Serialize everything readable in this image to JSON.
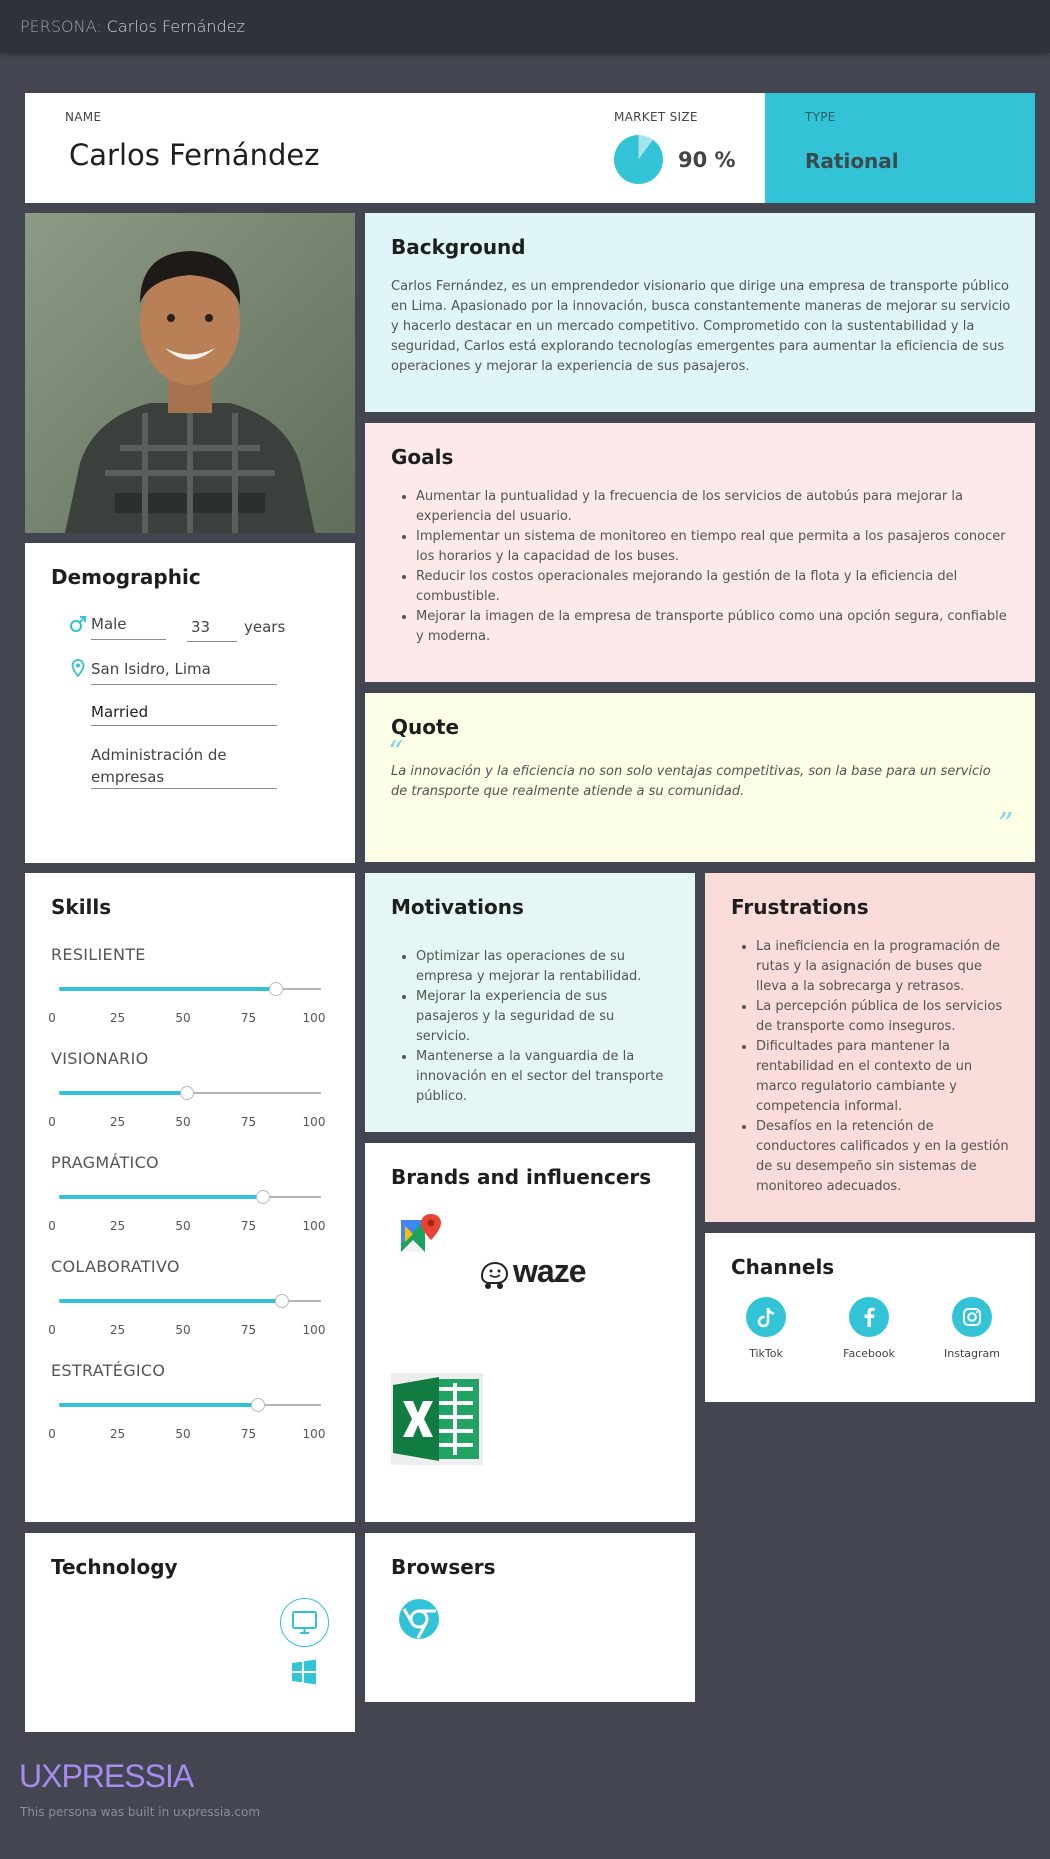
{
  "topbar": {
    "prefix": "PERSONA:",
    "name": "Carlos Fernández"
  },
  "header": {
    "name_label": "NAME",
    "name": "Carlos Fernández",
    "market_label": "MARKET SIZE",
    "market_value": "90 %",
    "market_fraction": 0.9,
    "type_label": "TYPE",
    "type_value": "Rational"
  },
  "background": {
    "title": "Background",
    "text": "Carlos Fernández, es un emprendedor visionario que dirige una empresa de transporte público en Lima. Apasionado por la innovación, busca constantemente maneras de mejorar su servicio y hacerlo destacar en un mercado competitivo. Comprometido con la sustentabilidad y la seguridad, Carlos está explorando tecnologías emergentes para aumentar la eficiencia de sus operaciones y mejorar la experiencia de sus pasajeros."
  },
  "goals": {
    "title": "Goals",
    "items": [
      "Aumentar la puntualidad y la frecuencia de los servicios de autobús para mejorar la experiencia del usuario.",
      "Implementar un sistema de monitoreo en tiempo real que permita a los pasajeros conocer los horarios y la capacidad de los buses.",
      "Reducir los costos operacionales mejorando la gestión de la flota y la eficiencia del combustible.",
      "Mejorar la imagen de la empresa de transporte público como una opción segura, confiable y moderna."
    ]
  },
  "demographic": {
    "title": "Demographic",
    "gender": "Male",
    "age": "33",
    "age_unit": "years",
    "location": "San Isidro, Lima",
    "status": "Married",
    "occupation": "Administración de empresas"
  },
  "quote": {
    "title": "Quote",
    "text": "La innovación y la eficiencia no son solo ventajas competitivas, son la base para un servicio de transporte que realmente atiende a su comunidad."
  },
  "skills": {
    "title": "Skills",
    "ticks": [
      "0",
      "25",
      "50",
      "75",
      "100"
    ],
    "items": [
      {
        "name": "RESILIENTE",
        "value": 83
      },
      {
        "name": "VISIONARIO",
        "value": 49
      },
      {
        "name": "PRAGMÁTICO",
        "value": 78
      },
      {
        "name": "COLABORATIVO",
        "value": 85
      },
      {
        "name": "ESTRATÉGICO",
        "value": 76
      }
    ]
  },
  "motivations": {
    "title": "Motivations",
    "items": [
      "Optimizar las operaciones de su empresa y mejorar la rentabilidad.",
      "Mejorar la experiencia de sus pasajeros y la seguridad de su servicio.",
      "Mantenerse a la vanguardia de la innovación en el sector del transporte público."
    ]
  },
  "frustrations": {
    "title": "Frustrations",
    "items": [
      "La ineficiencia en la programación de rutas y la asignación de buses que lleva a la sobrecarga y retrasos.",
      "La percepción pública de los servicios de transporte como inseguros.",
      "Dificultades para mantener la rentabilidad en el contexto de un marco regulatorio cambiante y competencia informal.",
      "Desafíos en la retención de conductores calificados y en la gestión de su desempeño sin sistemas de monitoreo adecuados."
    ]
  },
  "brands": {
    "title": "Brands and influencers",
    "waze_text": "waze"
  },
  "channels": {
    "title": "Channels",
    "items": [
      {
        "label": "TikTok",
        "icon": "tiktok-icon"
      },
      {
        "label": "Facebook",
        "icon": "facebook-icon"
      },
      {
        "label": "Instagram",
        "icon": "instagram-icon"
      }
    ]
  },
  "technology": {
    "title": "Technology"
  },
  "browsers": {
    "title": "Browsers"
  },
  "footer": {
    "logo": "UXPRESSIA",
    "note": "This persona was built in uxpressia.com"
  },
  "colors": {
    "accent": "#33c3d6",
    "background_card": "#e0f5f8",
    "goals_card": "#fde9e9",
    "quote_card": "#fdfee6",
    "motivations_card": "#e5f7f4",
    "frustrations_card": "#fadcdb",
    "logo": "#a88bf0"
  }
}
